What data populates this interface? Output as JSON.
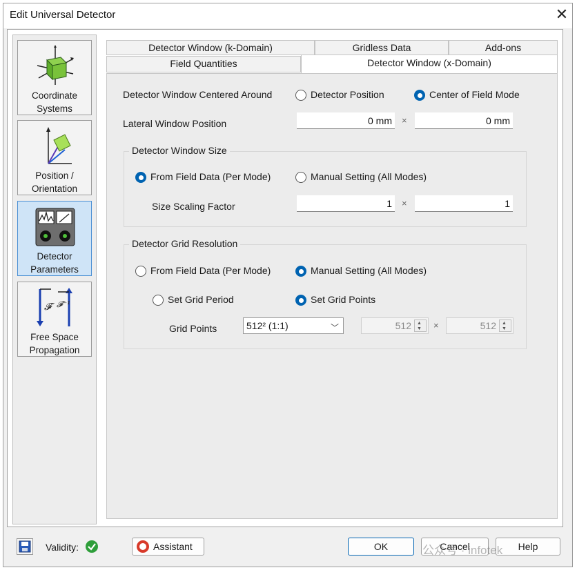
{
  "window": {
    "title": "Edit Universal Detector",
    "close_glyph": "✕"
  },
  "sidebar": {
    "items": [
      {
        "label": "Coordinate\nSystems",
        "icon": "coordinate-cube-icon"
      },
      {
        "label": "Position /\nOrientation",
        "icon": "position-axes-icon"
      },
      {
        "label": "Detector\nParameters",
        "icon": "detector-meter-icon",
        "selected": true
      },
      {
        "label": "Free Space\nPropagation",
        "icon": "fourier-transform-icon"
      }
    ]
  },
  "tabs": {
    "row1": [
      "Detector Window (k-Domain)",
      "Gridless Data",
      "Add-ons"
    ],
    "row2": [
      "Field Quantities",
      "Detector Window (x-Domain)"
    ],
    "active": "Detector Window (x-Domain)"
  },
  "centered": {
    "label": "Detector Window Centered Around",
    "options": [
      "Detector Position",
      "Center of Field Mode"
    ],
    "selected": "Center of Field Mode"
  },
  "lateral": {
    "label": "Lateral Window Position",
    "x": "0 mm",
    "y": "0 mm",
    "sep": "×"
  },
  "window_size": {
    "title": "Detector Window Size",
    "options": [
      "From Field Data (Per Mode)",
      "Manual Setting (All Modes)"
    ],
    "selected": "From Field Data (Per Mode)",
    "scaling_label": "Size Scaling Factor",
    "scale_x": "1",
    "scale_y": "1",
    "sep": "×"
  },
  "grid_res": {
    "title": "Detector Grid Resolution",
    "options": [
      "From Field Data (Per Mode)",
      "Manual Setting (All Modes)"
    ],
    "selected": "Manual Setting (All Modes)",
    "sub_options": [
      "Set Grid Period",
      "Set Grid Points"
    ],
    "sub_selected": "Set Grid Points",
    "grid_points_label": "Grid Points",
    "grid_points_value": "512² (1:1)",
    "gx": "512",
    "gy": "512",
    "sep": "×"
  },
  "footer": {
    "validity_label": "Validity:",
    "assistant_label": "Assistant",
    "ok_label": "OK",
    "cancel_label": "Cancel",
    "help_label": "Help",
    "watermark": "公众号 · infotek"
  },
  "colors": {
    "accent": "#0063b1",
    "valid_green": "#2e9e3a",
    "selected_nav": "#cfe4f7"
  }
}
